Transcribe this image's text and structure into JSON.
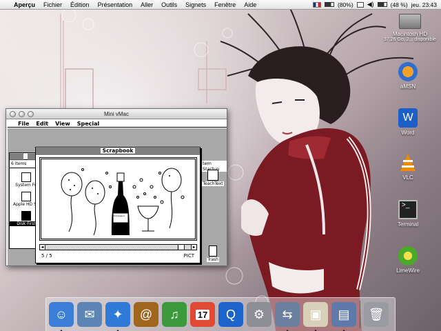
{
  "menubar": {
    "apple_icon": "apple-icon",
    "app_name": "Aperçu",
    "menus": [
      "Fichier",
      "Édition",
      "Présentation",
      "Aller",
      "Outils",
      "Signets",
      "Fenêtre",
      "Aide"
    ],
    "battery_percent": "(80%)",
    "battery_text": "(48 %)",
    "clock": "jeu. 23:43"
  },
  "desktop_icons": [
    {
      "label": "Macintosh HD",
      "sublabel": "37,26 Go, 2... disponible",
      "icon": "hard-drive-icon",
      "color": "#8a8a8a"
    },
    {
      "label": "aMSN",
      "icon": "amsn-icon",
      "color": "#2f6fd0"
    },
    {
      "label": "Word",
      "icon": "word-icon",
      "color": "#1b5fc7"
    },
    {
      "label": "VLC",
      "icon": "vlc-cone-icon",
      "color": "#f08a00"
    },
    {
      "label": "Terminal",
      "icon": "terminal-icon",
      "color": "#222222"
    },
    {
      "label": "LimeWire",
      "icon": "limewire-icon",
      "color": "#4aa82a"
    }
  ],
  "vmac": {
    "title": "Mini vMac",
    "classic_menus": [
      "File",
      "Edit",
      "View",
      "Special"
    ],
    "finder_count": "6 items",
    "finder_icons": [
      "System Fo",
      "Apple HD SC",
      "Disk First"
    ],
    "right_window_title": "tem Startup",
    "desktop_icons": [
      "TeachText",
      "Trash"
    ],
    "scrapbook": {
      "title": "Scrapbook",
      "page": "5 / 5",
      "type": "PICT",
      "bottle_label": "Champagne"
    }
  },
  "dock": {
    "items": [
      {
        "name": "finder",
        "icon": "finder-icon",
        "color": "#3a7ed8",
        "running": true
      },
      {
        "name": "mail",
        "icon": "mail-icon",
        "color": "#5c84b5",
        "running": false
      },
      {
        "name": "safari",
        "icon": "safari-icon",
        "color": "#2f7ad6",
        "running": true
      },
      {
        "name": "address-book",
        "icon": "address-book-icon",
        "color": "#a0661d",
        "running": false
      },
      {
        "name": "itunes",
        "icon": "itunes-icon",
        "color": "#3c9a3c",
        "running": false
      },
      {
        "name": "ical",
        "icon": "ical-icon",
        "color": "#e04a35",
        "running": false,
        "text": "17"
      },
      {
        "name": "quicktime",
        "icon": "quicktime-icon",
        "color": "#1e63c9",
        "running": false
      },
      {
        "name": "system-preferences",
        "icon": "system-preferences-icon",
        "color": "#8d8d96",
        "running": false
      },
      {
        "name": "network-utility",
        "icon": "network-icon",
        "color": "#6b7fa0",
        "running": true
      },
      {
        "name": "mini-vmac",
        "icon": "mini-vmac-icon",
        "color": "#d8d0b8",
        "running": true
      },
      {
        "name": "preview",
        "icon": "preview-icon",
        "color": "#5f7aa8",
        "running": true
      },
      {
        "name": "trash",
        "icon": "trash-icon",
        "color": "#9a9aa2",
        "running": false
      }
    ]
  }
}
